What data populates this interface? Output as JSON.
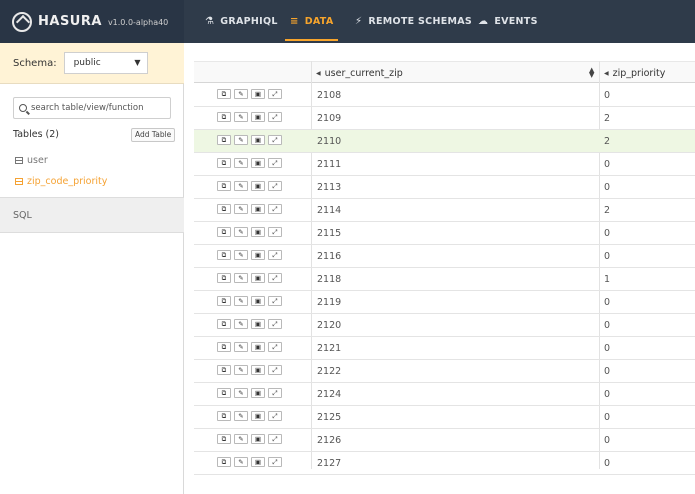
{
  "app": {
    "name": "HASURA",
    "version": "v1.0.0-alpha40"
  },
  "nav": [
    {
      "label": "GRAPHIQL",
      "icon": "flask-icon"
    },
    {
      "label": "DATA",
      "icon": "database-icon"
    },
    {
      "label": "REMOTE SCHEMAS",
      "icon": "plug-icon"
    },
    {
      "label": "EVENTS",
      "icon": "cloud-icon"
    }
  ],
  "sidebar": {
    "schema_label": "Schema:",
    "schema_value": "public",
    "search_placeholder": "search table/view/function",
    "tables_heading": "Tables (2)",
    "add_table_label": "Add Table",
    "tables": [
      "user",
      "zip_code_priority"
    ],
    "sql_label": "SQL"
  },
  "grid": {
    "columns": [
      "user_current_zip",
      "zip_priority"
    ],
    "rows": [
      {
        "zip": "2108",
        "priority": "0"
      },
      {
        "zip": "2109",
        "priority": "2"
      },
      {
        "zip": "2110",
        "priority": "2"
      },
      {
        "zip": "2111",
        "priority": "0"
      },
      {
        "zip": "2113",
        "priority": "0"
      },
      {
        "zip": "2114",
        "priority": "2"
      },
      {
        "zip": "2115",
        "priority": "0"
      },
      {
        "zip": "2116",
        "priority": "0"
      },
      {
        "zip": "2118",
        "priority": "1"
      },
      {
        "zip": "2119",
        "priority": "0"
      },
      {
        "zip": "2120",
        "priority": "0"
      },
      {
        "zip": "2121",
        "priority": "0"
      },
      {
        "zip": "2122",
        "priority": "0"
      },
      {
        "zip": "2124",
        "priority": "0"
      },
      {
        "zip": "2125",
        "priority": "0"
      },
      {
        "zip": "2126",
        "priority": "0"
      },
      {
        "zip": "2127",
        "priority": "0"
      }
    ],
    "row_actions": [
      "copy-icon",
      "edit-icon",
      "delete-icon",
      "expand-icon"
    ]
  },
  "colors": {
    "topbar": "#2f3b4a",
    "accent": "#f8a52c",
    "highlight_row": "#eef7e3",
    "schema_bg": "#fff3d6"
  }
}
